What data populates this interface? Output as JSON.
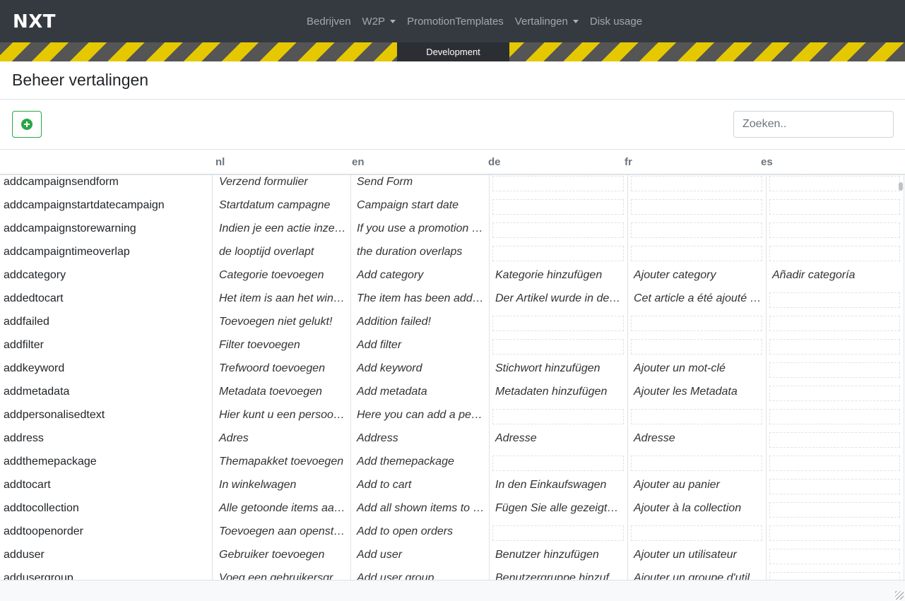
{
  "brand": "NXT",
  "nav": [
    {
      "label": "Bedrijven",
      "dropdown": false
    },
    {
      "label": "W2P",
      "dropdown": true
    },
    {
      "label": "PromotionTemplates",
      "dropdown": false
    },
    {
      "label": "Vertalingen",
      "dropdown": true
    },
    {
      "label": "Disk usage",
      "dropdown": false
    }
  ],
  "environment": "Development",
  "page_title": "Beheer vertalingen",
  "search": {
    "placeholder": "Zoeken.."
  },
  "columns": [
    "",
    "nl",
    "en",
    "de",
    "fr",
    "es"
  ],
  "rows": [
    {
      "key": "addcampaignsendform",
      "nl": "Verzend formulier",
      "en": "Send Form",
      "de": "",
      "fr": "",
      "es": ""
    },
    {
      "key": "addcampaignstartdatecampaign",
      "nl": "Startdatum campagne",
      "en": "Campaign start date",
      "de": "",
      "fr": "",
      "es": ""
    },
    {
      "key": "addcampaignstorewarning",
      "nl": "Indien je een actie inzet…",
      "en": "If you use a promotion …",
      "de": "",
      "fr": "",
      "es": ""
    },
    {
      "key": "addcampaigntimeoverlap",
      "nl": "de looptijd overlapt",
      "en": "the duration overlaps",
      "de": "",
      "fr": "",
      "es": ""
    },
    {
      "key": "addcategory",
      "nl": "Categorie toevoegen",
      "en": "Add category",
      "de": "Kategorie hinzufügen",
      "fr": "Ajouter category",
      "es": "Añadir categoría"
    },
    {
      "key": "addedtocart",
      "nl": "Het item is aan het win…",
      "en": "The item has been adde…",
      "de": "Der Artikel wurde in de…",
      "fr": "Cet article a été ajouté …",
      "es": ""
    },
    {
      "key": "addfailed",
      "nl": "Toevoegen niet gelukt!",
      "en": "Addition failed!",
      "de": "",
      "fr": "",
      "es": ""
    },
    {
      "key": "addfilter",
      "nl": "Filter toevoegen",
      "en": "Add filter",
      "de": "",
      "fr": "",
      "es": ""
    },
    {
      "key": "addkeyword",
      "nl": "Trefwoord toevoegen",
      "en": "Add keyword",
      "de": "Stichwort hinzufügen",
      "fr": "Ajouter un mot-clé",
      "es": ""
    },
    {
      "key": "addmetadata",
      "nl": "Metadata toevoegen",
      "en": "Add metadata",
      "de": "Metadaten hinzufügen",
      "fr": "Ajouter les Metadata",
      "es": ""
    },
    {
      "key": "addpersonalisedtext",
      "nl": "Hier kunt u een persoon…",
      "en": "Here you can add a per…",
      "de": "",
      "fr": "",
      "es": ""
    },
    {
      "key": "address",
      "nl": "Adres",
      "en": "Address",
      "de": "Adresse",
      "fr": "Adresse",
      "es": ""
    },
    {
      "key": "addthemepackage",
      "nl": "Themapakket toevoegen",
      "en": "Add themepackage",
      "de": "",
      "fr": "",
      "es": ""
    },
    {
      "key": "addtocart",
      "nl": "In winkelwagen",
      "en": "Add to cart",
      "de": "In den Einkaufswagen",
      "fr": "Ajouter au panier",
      "es": ""
    },
    {
      "key": "addtocollection",
      "nl": "Alle getoonde items aa…",
      "en": "Add all shown items to …",
      "de": "Fügen Sie alle gezeigten…",
      "fr": "Ajouter à la collection",
      "es": ""
    },
    {
      "key": "addtoopenorder",
      "nl": "Toevoegen aan opensta…",
      "en": "Add to open orders",
      "de": "",
      "fr": "",
      "es": ""
    },
    {
      "key": "adduser",
      "nl": "Gebruiker toevoegen",
      "en": "Add user",
      "de": "Benutzer hinzufügen",
      "fr": "Ajouter un utilisateur",
      "es": ""
    },
    {
      "key": "addusergroup",
      "nl": "Voeg een gebruikersgro…",
      "en": "Add user group",
      "de": "Benutzergruppe hinzufü…",
      "fr": "Ajouter un groupe d'util…",
      "es": ""
    }
  ]
}
